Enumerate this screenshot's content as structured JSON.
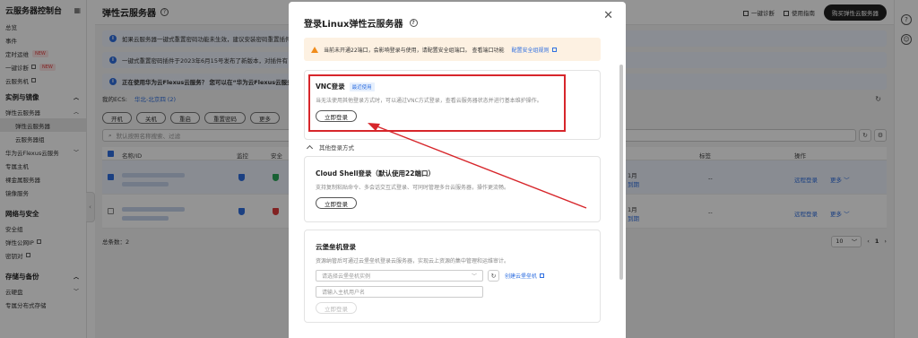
{
  "sidebar": {
    "title": "云服务器控制台",
    "items": [
      {
        "label": "总览",
        "badge": "",
        "ext": false
      },
      {
        "label": "事件",
        "badge": "",
        "ext": false
      },
      {
        "label": "定时运维",
        "badge": "NEW",
        "ext": false
      },
      {
        "label": "一键诊断",
        "badge": "NEW",
        "ext": true
      },
      {
        "label": "云服务机",
        "badge": "",
        "ext": true
      }
    ],
    "section_instances": "实例与镜像",
    "instance_items": [
      {
        "label": "弹性云服务器",
        "sub": false,
        "active": false
      },
      {
        "label": "弹性云服务器",
        "sub": true,
        "active": true
      },
      {
        "label": "云服务器组",
        "sub": true,
        "active": false
      },
      {
        "label": "华为云Flexus云服务",
        "sub": false,
        "active": false
      },
      {
        "label": "专属主机",
        "sub": false,
        "active": false
      },
      {
        "label": "裸金属服务器",
        "sub": false,
        "active": false
      },
      {
        "label": "镜像服务",
        "sub": false,
        "active": false
      }
    ],
    "section_network": "网络与安全",
    "network_items": [
      {
        "label": "安全组",
        "ext": false
      },
      {
        "label": "弹性公网IP",
        "ext": true
      },
      {
        "label": "密钥对",
        "ext": true
      }
    ],
    "section_storage": "存储与备份",
    "storage_items": [
      {
        "label": "云硬盘"
      },
      {
        "label": "专属分布式存储"
      }
    ]
  },
  "header": {
    "title": "弹性云服务器",
    "diagnose": "一键诊断",
    "guide": "使用指南",
    "buy": "购买弹性云服务器"
  },
  "notices": [
    "如果云服务器一键式重置密码功能未生效，建议安装密码重置插件。",
    "一键式重置密码插件于2023年6月15号发布了新版本，对插件有",
    "正在使用华为云Flexus云服务？ 您可以在“华为云Flexus云服务"
  ],
  "ecs_row": {
    "label": "我的ECS:",
    "region": "华北-北京四 (2)"
  },
  "action_buttons": [
    "开机",
    "关机",
    "重启",
    "重置密码",
    "更多"
  ],
  "search_placeholder": "默认按照名称搜索、过滤",
  "table": {
    "headers": {
      "name": "名称/ID",
      "monitor": "监控",
      "security": "安全",
      "tags": "标签",
      "ops": "操作"
    },
    "rows": [
      {
        "date": "1月",
        "bill": "到期",
        "tag": "--",
        "remote": "远程登录",
        "more": "更多"
      },
      {
        "date": "1月",
        "bill": "到期",
        "tag": "--",
        "remote": "远程登录",
        "more": "更多"
      }
    ]
  },
  "footer": {
    "total": "总条数：2",
    "page_size": "10",
    "page": "1"
  },
  "dialog": {
    "title": "登录Linux弹性云服务器",
    "warning": "当前未开通22端口，会影响登录与使用，请配置安全组端口。 查看端口功能",
    "warning_link": "配置安全组规则",
    "vnc": {
      "title": "VNC登录",
      "tag": "最近使用",
      "desc": "当无法使用其他登录方式时，可以通过VNC方式登录，查看云服务器状态并进行基本维护操作。",
      "button": "立即登录"
    },
    "other_label": "其他登录方式",
    "cloudshell": {
      "title": "Cloud Shell登录（默认使用22端口）",
      "desc": "支持复制粘贴命令、多会话交互式登录、可同时管理多台云服务器，操作更流畅。",
      "button": "立即登录"
    },
    "bastion": {
      "title": "云堡垒机登录",
      "desc": "资源纳管后可通过云堡垒机登录云服务器，实现云上资源的集中管理和运维审计。",
      "select_placeholder": "请选择云堡垒机实例",
      "create_link": "创建云堡垒机",
      "user_placeholder": "请输入主机用户名",
      "button": "立即登录"
    }
  }
}
